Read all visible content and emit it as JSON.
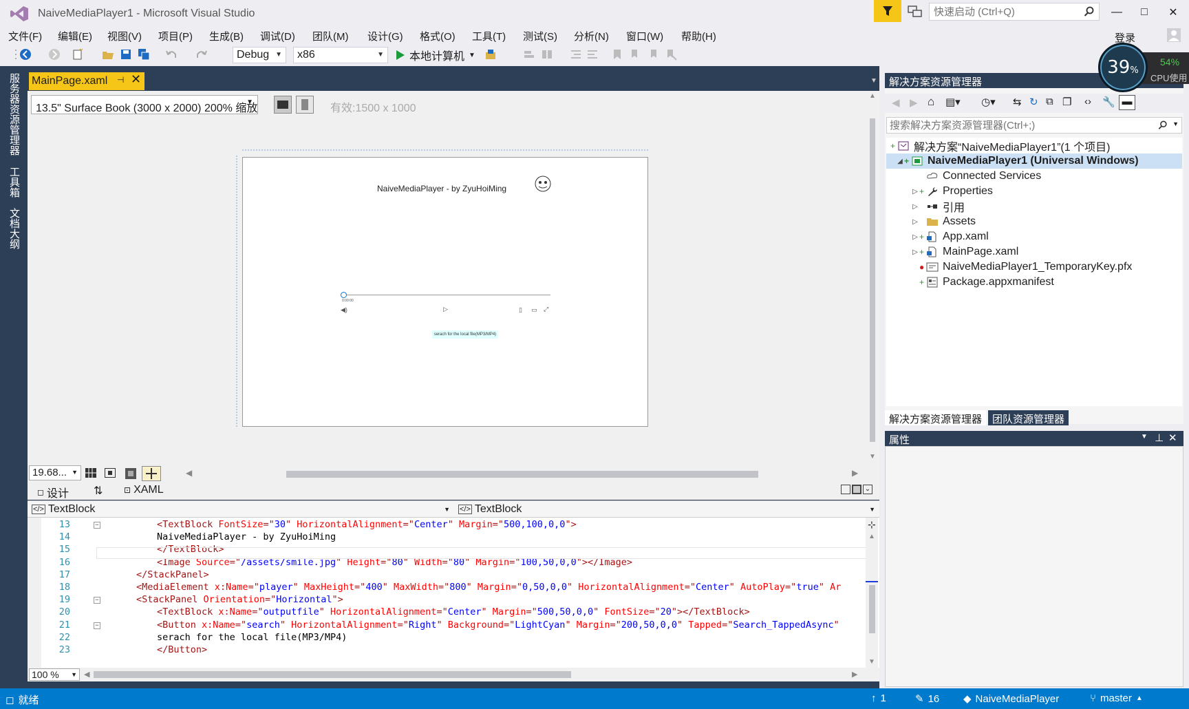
{
  "window": {
    "title": "NaiveMediaPlayer1 - Microsoft Visual Studio",
    "quick_launch_placeholder": "快速启动 (Ctrl+Q)",
    "minimize": "—",
    "maximize": "□",
    "close": "✕",
    "login": "登录"
  },
  "menu": [
    "文件(F)",
    "编辑(E)",
    "视图(V)",
    "项目(P)",
    "生成(B)",
    "调试(D)",
    "团队(M)",
    "设计(G)",
    "格式(O)",
    "工具(T)",
    "测试(S)",
    "分析(N)",
    "窗口(W)",
    "帮助(H)"
  ],
  "toolbar": {
    "config": "Debug",
    "platform": "x86",
    "run_label": "本地计算机"
  },
  "cpu": {
    "value": "39",
    "unit": "%",
    "side_value": "54%",
    "label": "CPU使用"
  },
  "left_tabs": [
    "服务器资源管理器",
    "工具箱",
    "文档大纲"
  ],
  "document_tab": {
    "label": "MainPage.xaml",
    "pin": "⊣",
    "close": "✕"
  },
  "designer": {
    "device": "13.5\" Surface Book (3000 x 2000) 200% 缩放",
    "effective": "有效:1500 x 1000",
    "zoom": "19.68...",
    "app_title": "NaiveMediaPlayer - by ZyuHoiMing",
    "search_button": "serach for the local file(MP3/MP4)",
    "time": "0:00:00"
  },
  "split_tabs": {
    "design": "设计",
    "swap": "⇅",
    "xaml": "XAML"
  },
  "code_nav": {
    "left": "TextBlock",
    "right": "TextBlock"
  },
  "code_lines": [
    {
      "n": "13",
      "indent": "    ",
      "parts": [
        [
          "tag",
          "<TextBlock "
        ],
        [
          "attr",
          "FontSize"
        ],
        [
          "tag",
          "=\""
        ],
        [
          "val",
          "30"
        ],
        [
          "tag",
          "\" "
        ],
        [
          "attr",
          "HorizontalAlignment"
        ],
        [
          "tag",
          "=\""
        ],
        [
          "val",
          "Center"
        ],
        [
          "tag",
          "\" "
        ],
        [
          "attr",
          "Margin"
        ],
        [
          "tag",
          "=\""
        ],
        [
          "val",
          "500,100,0,0"
        ],
        [
          "tag",
          "\">"
        ]
      ],
      "fold": "−"
    },
    {
      "n": "14",
      "indent": "    ",
      "parts": [
        [
          "txt",
          "NaiveMediaPlayer - by ZyuHoiMing"
        ]
      ]
    },
    {
      "n": "15",
      "indent": "    ",
      "parts": [
        [
          "tag",
          "</TextBlock>"
        ]
      ]
    },
    {
      "n": "16",
      "indent": "    ",
      "parts": [
        [
          "tag",
          "<Image "
        ],
        [
          "attr",
          "Source"
        ],
        [
          "tag",
          "=\""
        ],
        [
          "val",
          "/assets/smile.jpg"
        ],
        [
          "tag",
          "\" "
        ],
        [
          "attr",
          "Height"
        ],
        [
          "tag",
          "=\""
        ],
        [
          "val",
          "80"
        ],
        [
          "tag",
          "\" "
        ],
        [
          "attr",
          "Width"
        ],
        [
          "tag",
          "=\""
        ],
        [
          "val",
          "80"
        ],
        [
          "tag",
          "\" "
        ],
        [
          "attr",
          "Margin"
        ],
        [
          "tag",
          "=\""
        ],
        [
          "val",
          "100,50,0,0"
        ],
        [
          "tag",
          "\"></Image>"
        ]
      ]
    },
    {
      "n": "17",
      "indent": "",
      "parts": [
        [
          "tag",
          "</StackPanel>"
        ]
      ]
    },
    {
      "n": "18",
      "indent": "",
      "parts": [
        [
          "tag",
          "<MediaElement "
        ],
        [
          "attr",
          "x:Name"
        ],
        [
          "tag",
          "=\""
        ],
        [
          "val",
          "player"
        ],
        [
          "tag",
          "\" "
        ],
        [
          "attr",
          "MaxHeight"
        ],
        [
          "tag",
          "=\""
        ],
        [
          "val",
          "400"
        ],
        [
          "tag",
          "\" "
        ],
        [
          "attr",
          "MaxWidth"
        ],
        [
          "tag",
          "=\""
        ],
        [
          "val",
          "800"
        ],
        [
          "tag",
          "\" "
        ],
        [
          "attr",
          "Margin"
        ],
        [
          "tag",
          "=\""
        ],
        [
          "val",
          "0,50,0,0"
        ],
        [
          "tag",
          "\" "
        ],
        [
          "attr",
          "HorizontalAlignment"
        ],
        [
          "tag",
          "=\""
        ],
        [
          "val",
          "Center"
        ],
        [
          "tag",
          "\" "
        ],
        [
          "attr",
          "AutoPlay"
        ],
        [
          "tag",
          "=\""
        ],
        [
          "val",
          "true"
        ],
        [
          "tag",
          "\" "
        ],
        [
          "attr",
          "Ar"
        ]
      ]
    },
    {
      "n": "19",
      "indent": "",
      "parts": [
        [
          "tag",
          "<StackPanel "
        ],
        [
          "attr",
          "Orientation"
        ],
        [
          "tag",
          "=\""
        ],
        [
          "val",
          "Horizontal"
        ],
        [
          "tag",
          "\">"
        ]
      ],
      "fold": "−"
    },
    {
      "n": "20",
      "indent": "    ",
      "parts": [
        [
          "tag",
          "<TextBlock "
        ],
        [
          "attr",
          "x:Name"
        ],
        [
          "tag",
          "=\""
        ],
        [
          "val",
          "outputfile"
        ],
        [
          "tag",
          "\" "
        ],
        [
          "attr",
          "HorizontalAlignment"
        ],
        [
          "tag",
          "=\""
        ],
        [
          "val",
          "Center"
        ],
        [
          "tag",
          "\" "
        ],
        [
          "attr",
          "Margin"
        ],
        [
          "tag",
          "=\""
        ],
        [
          "val",
          "500,50,0,0"
        ],
        [
          "tag",
          "\" "
        ],
        [
          "attr",
          "FontSize"
        ],
        [
          "tag",
          "=\""
        ],
        [
          "val",
          "20"
        ],
        [
          "tag",
          "\"></TextBlock>"
        ]
      ]
    },
    {
      "n": "21",
      "indent": "    ",
      "parts": [
        [
          "tag",
          "<Button "
        ],
        [
          "attr",
          "x:Name"
        ],
        [
          "tag",
          "=\""
        ],
        [
          "val",
          "search"
        ],
        [
          "tag",
          "\" "
        ],
        [
          "attr",
          "HorizontalAlignment"
        ],
        [
          "tag",
          "=\""
        ],
        [
          "val",
          "Right"
        ],
        [
          "tag",
          "\" "
        ],
        [
          "attr",
          "Background"
        ],
        [
          "tag",
          "=\""
        ],
        [
          "val",
          "LightCyan"
        ],
        [
          "tag",
          "\" "
        ],
        [
          "attr",
          "Margin"
        ],
        [
          "tag",
          "=\""
        ],
        [
          "val",
          "200,50,0,0"
        ],
        [
          "tag",
          "\" "
        ],
        [
          "attr",
          "Tapped"
        ],
        [
          "tag",
          "=\""
        ],
        [
          "val",
          "Search_TappedAsync"
        ],
        [
          "tag",
          "\""
        ]
      ],
      "fold": "−"
    },
    {
      "n": "22",
      "indent": "        ",
      "parts": [
        [
          "txt",
          "serach for the local file(MP3/MP4)"
        ]
      ]
    },
    {
      "n": "23",
      "indent": "    ",
      "parts": [
        [
          "tag",
          "</Button>"
        ]
      ]
    }
  ],
  "editor_zoom": "100 %",
  "solution_explorer": {
    "title": "解决方案资源管理器",
    "search_placeholder": "搜索解决方案资源管理器(Ctrl+;)",
    "items": [
      {
        "label": "解决方案“NaiveMediaPlayer1”(1 个项目)",
        "icon": "solution-icon"
      },
      {
        "label": "NaiveMediaPlayer1 (Universal Windows)",
        "icon": "project-icon"
      },
      {
        "label": "Connected Services",
        "icon": "connected-services-icon"
      },
      {
        "label": "Properties",
        "icon": "wrench-icon"
      },
      {
        "label": "引用",
        "icon": "references-icon"
      },
      {
        "label": "Assets",
        "icon": "folder-icon"
      },
      {
        "label": "App.xaml",
        "icon": "xaml-file-icon"
      },
      {
        "label": "MainPage.xaml",
        "icon": "xaml-file-icon"
      },
      {
        "label": "NaiveMediaPlayer1_TemporaryKey.pfx",
        "icon": "certificate-icon"
      },
      {
        "label": "Package.appxmanifest",
        "icon": "manifest-icon"
      }
    ],
    "bottom_tabs": [
      "解决方案资源管理器",
      "团队资源管理器"
    ]
  },
  "properties": {
    "title": "属性"
  },
  "status": {
    "ready": "就绪",
    "up": "1",
    "edits": "16",
    "repo": "NaiveMediaPlayer",
    "branch": "master"
  },
  "colors": {
    "accent": "#007acc",
    "tab_active": "#f5c518",
    "panel_header": "#2d3e57"
  }
}
